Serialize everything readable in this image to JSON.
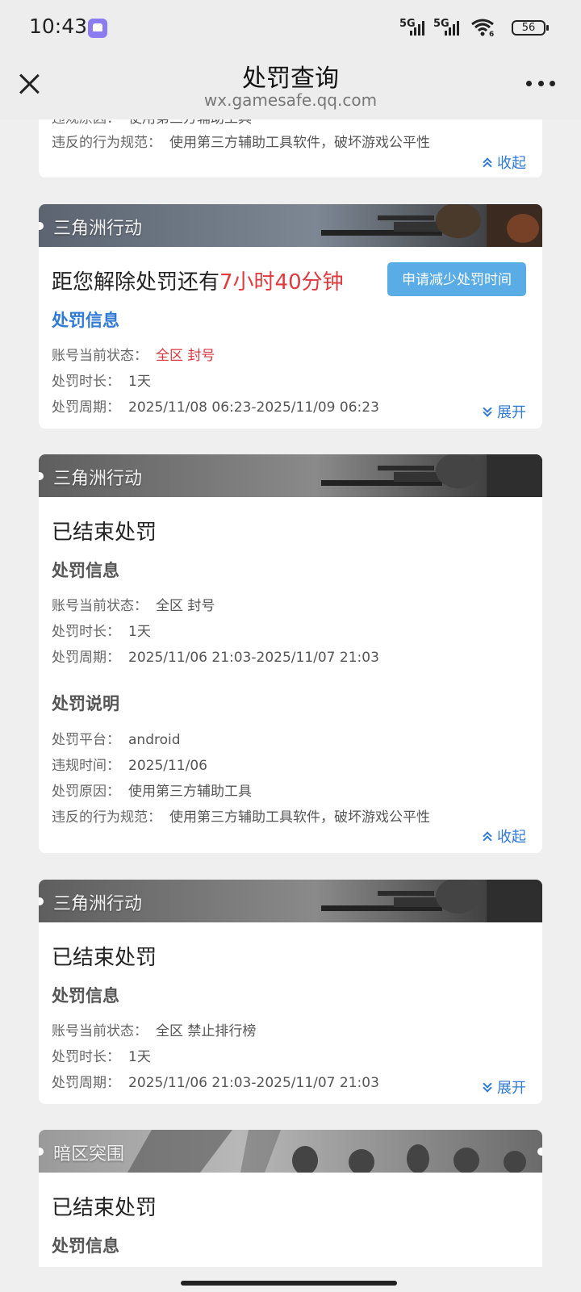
{
  "status_bar": {
    "time": "10:43",
    "sim1": "5G",
    "sim2": "5G",
    "wifi_sub": "6",
    "battery": "56"
  },
  "nav": {
    "title": "处罚查询",
    "subtitle": "wx.gamesafe.qq.com"
  },
  "card0": {
    "row_cut_label": "违规原因：",
    "row_cut_value": "使用第三方辅助工具",
    "rule_label": "违反的行为规范：",
    "rule_value": "使用第三方辅助工具软件，破坏游戏公平性",
    "toggle": "收起"
  },
  "card1": {
    "game": "三角洲行动",
    "headline_prefix": "距您解除处罚还有",
    "headline_remaining": "7小时40分钟",
    "apply_button": "申请减少处罚时间",
    "info_title": "处罚信息",
    "status_label": "账号当前状态：",
    "status_value": "全区 封号",
    "duration_label": "处罚时长：",
    "duration_value": "1天",
    "period_label": "处罚周期：",
    "period_value": "2025/11/08 06:23-2025/11/09 06:23",
    "toggle": "展开"
  },
  "card2": {
    "game": "三角洲行动",
    "headline": "已结束处罚",
    "info_title": "处罚信息",
    "status_label": "账号当前状态：",
    "status_value": "全区 封号",
    "duration_label": "处罚时长：",
    "duration_value": "1天",
    "period_label": "处罚周期：",
    "period_value": "2025/11/06 21:03-2025/11/07 21:03",
    "desc_title": "处罚说明",
    "platform_label": "处罚平台：",
    "platform_value": "android",
    "time_label": "违规时间：",
    "time_value": "2025/11/06",
    "reason_label": "处罚原因：",
    "reason_value": "使用第三方辅助工具",
    "rule_label": "违反的行为规范：",
    "rule_value": "使用第三方辅助工具软件，破坏游戏公平性",
    "toggle": "收起"
  },
  "card3": {
    "game": "三角洲行动",
    "headline": "已结束处罚",
    "info_title": "处罚信息",
    "status_label": "账号当前状态：",
    "status_value": "全区 禁止排行榜",
    "duration_label": "处罚时长：",
    "duration_value": "1天",
    "period_label": "处罚周期：",
    "period_value": "2025/11/06 21:03-2025/11/07 21:03",
    "toggle": "展开"
  },
  "card4": {
    "game": "暗区突围",
    "headline": "已结束处罚",
    "info_title": "处罚信息"
  },
  "colors": {
    "accent_blue": "#2f7ad6",
    "alert_red": "#e0393e",
    "button_blue": "#5aace6"
  }
}
